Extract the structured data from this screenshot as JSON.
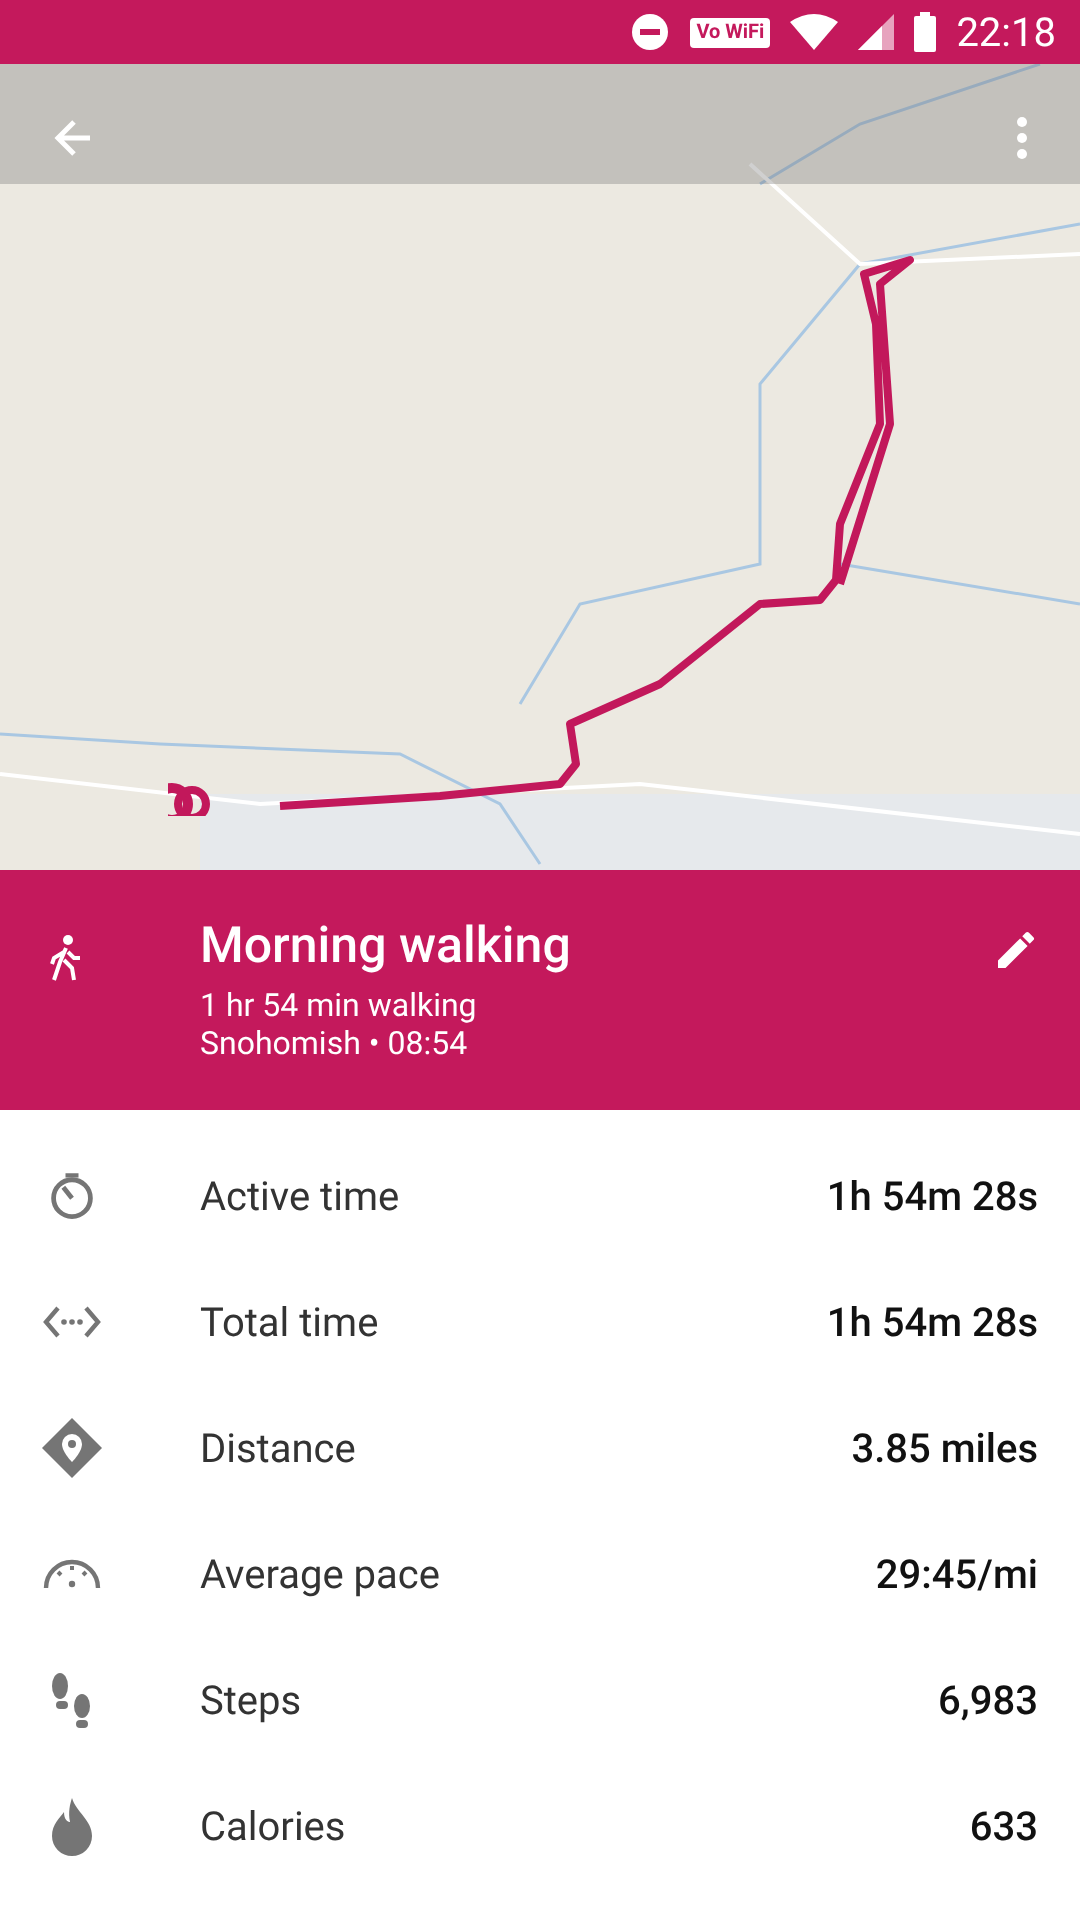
{
  "status_bar": {
    "badge": "Vo WiFi",
    "time": "22:18"
  },
  "activity": {
    "title": "Morning walking",
    "summary": "1 hr 54 min walking",
    "place_time": "Snohomish • 08:54"
  },
  "stats": [
    {
      "kind": "timer",
      "label": "Active time",
      "value": "1h 54m 28s"
    },
    {
      "kind": "span",
      "label": "Total time",
      "value": "1h 54m 28s"
    },
    {
      "kind": "distance",
      "label": "Distance",
      "value": "3.85 miles"
    },
    {
      "kind": "pace",
      "label": "Average pace",
      "value": "29:45/mi"
    },
    {
      "kind": "steps",
      "label": "Steps",
      "value": "6,983"
    },
    {
      "kind": "calories",
      "label": "Calories",
      "value": "633"
    }
  ]
}
